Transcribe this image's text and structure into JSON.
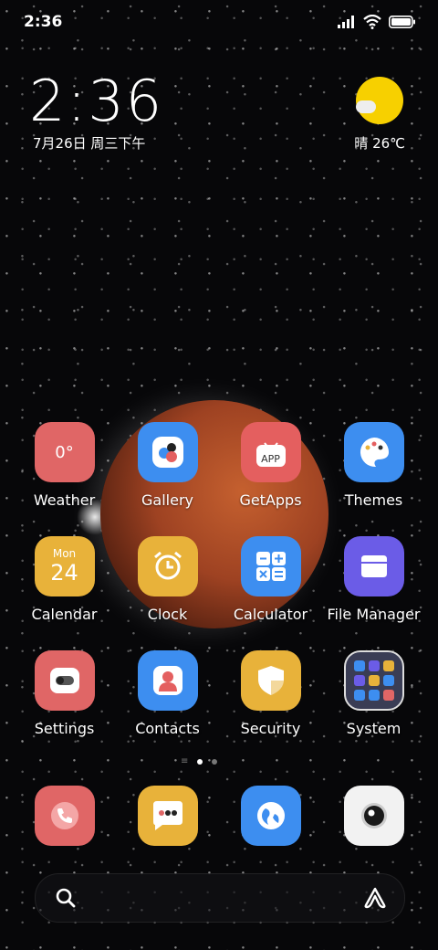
{
  "status_bar": {
    "time": "2:36"
  },
  "lock_clock": {
    "time": "2:36",
    "date": "7月26日 周三下午"
  },
  "weather_widget": {
    "text": "晴 26℃"
  },
  "apps": [
    {
      "label": "Weather",
      "icon": "weather-icon",
      "badge": "0°",
      "color": "#e06666"
    },
    {
      "label": "Gallery",
      "icon": "gallery-icon",
      "color": "#3d8ef0"
    },
    {
      "label": "GetApps",
      "icon": "getapps-icon",
      "badge": "APP",
      "color": "#e45f5f"
    },
    {
      "label": "Themes",
      "icon": "themes-icon",
      "color": "#3d8ef0"
    },
    {
      "label": "Calendar",
      "icon": "calendar-icon",
      "day": "Mon",
      "date": "24",
      "color": "#e8b23a"
    },
    {
      "label": "Clock",
      "icon": "clock-icon",
      "color": "#e8b23a"
    },
    {
      "label": "Calculator",
      "icon": "calculator-icon",
      "color": "#3d8ef0"
    },
    {
      "label": "File Manager",
      "icon": "folder-icon",
      "color": "#6b5ce7"
    },
    {
      "label": "Settings",
      "icon": "settings-icon",
      "color": "#e06666"
    },
    {
      "label": "Contacts",
      "icon": "contacts-icon",
      "color": "#3d8ef0"
    },
    {
      "label": "Security",
      "icon": "security-icon",
      "color": "#e8b23a"
    },
    {
      "label": "System",
      "icon": "system-folder-icon",
      "color": "#3a3d55"
    }
  ],
  "dock": [
    {
      "icon": "phone-icon",
      "color": "#e06666"
    },
    {
      "icon": "messages-icon",
      "color": "#e8b23a"
    },
    {
      "icon": "browser-icon",
      "color": "#3d8ef0"
    },
    {
      "icon": "camera-icon",
      "color": "#f2f2f2"
    }
  ]
}
